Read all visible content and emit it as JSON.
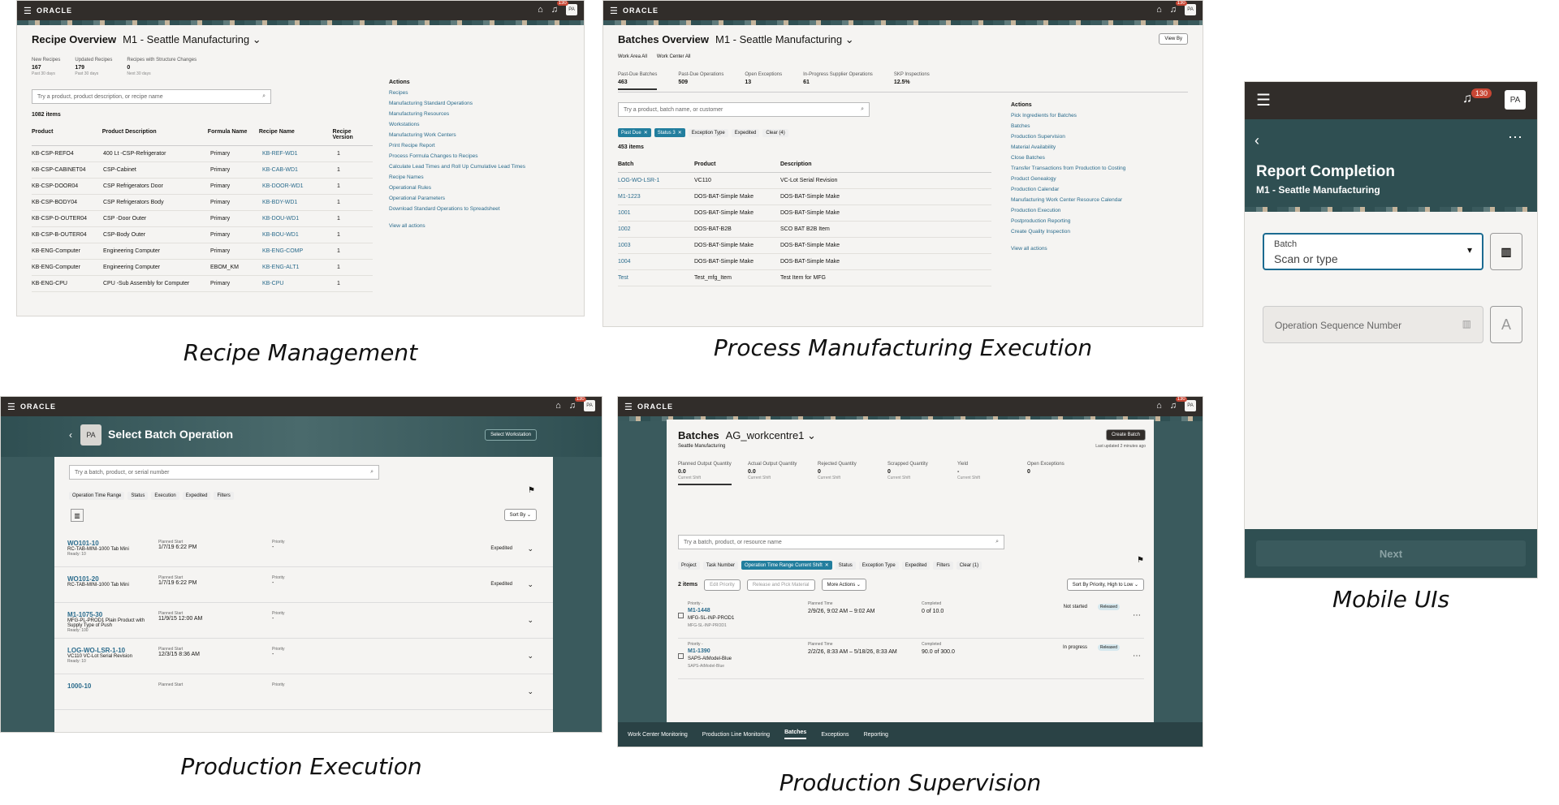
{
  "recipe": {
    "app_logo": "ORACLE",
    "title": "Recipe Overview",
    "context": "M1 - Seattle Manufacturing",
    "notif_count": "130",
    "avatar": "PA",
    "metrics": [
      {
        "label": "New Recipes",
        "value": "167",
        "sub": "Past 30 days"
      },
      {
        "label": "Updated Recipes",
        "value": "179",
        "sub": "Past 30 days"
      },
      {
        "label": "Recipes with Structure Changes",
        "value": "0",
        "sub": "Next 30 days"
      }
    ],
    "search_placeholder": "Try a product, product description, or recipe name",
    "count": "1082 items",
    "columns": [
      "Product",
      "Product Description",
      "Formula Name",
      "Recipe Name",
      "Recipe Version"
    ],
    "rows": [
      [
        "KB-CSP-REFO4",
        "400 Lt -CSP-Refrigerator",
        "Primary",
        "KB-REF-WD1",
        "1"
      ],
      [
        "KB-CSP-CABINET04",
        "CSP-Cabinet",
        "Primary",
        "KB-CAB-WD1",
        "1"
      ],
      [
        "KB-CSP-DOOR04",
        "CSP Refrigerators Door",
        "Primary",
        "KB-DOOR-WD1",
        "1"
      ],
      [
        "KB-CSP-BODY04",
        "CSP Refrigerators Body",
        "Primary",
        "KB-BDY-WD1",
        "1"
      ],
      [
        "KB-CSP-D-OUTER04",
        "CSP -Door Outer",
        "Primary",
        "KB-DOU-WD1",
        "1"
      ],
      [
        "KB-CSP-B-OUTER04",
        "CSP-Body Outer",
        "Primary",
        "KB-BOU-WD1",
        "1"
      ],
      [
        "KB-ENG-Computer",
        "Engineering Computer",
        "Primary",
        "KB-ENG-COMP",
        "1"
      ],
      [
        "KB-ENG-Computer",
        "Engineering Computer",
        "EBOM_KM",
        "KB-ENG-ALT1",
        "1"
      ],
      [
        "KB-ENG-CPU",
        "CPU -Sub Assembly for Computer",
        "Primary",
        "KB-CPU",
        "1"
      ]
    ],
    "actions_title": "Actions",
    "actions": [
      "Recipes",
      "Manufacturing Standard Operations",
      "Manufacturing Resources",
      "Workstations",
      "Manufacturing Work Centers",
      "Print Recipe Report",
      "Process Formula Changes to Recipes",
      "Calculate Lead Times and Roll Up Cumulative Lead Times",
      "Recipe Names",
      "Operational Rules",
      "Operational Parameters",
      "Download Standard Operations to Spreadsheet"
    ],
    "view_all": "View all actions",
    "caption": "Recipe Management"
  },
  "pme": {
    "app_logo": "ORACLE",
    "title": "Batches Overview",
    "context": "M1 - Seattle Manufacturing",
    "view_by": "View By",
    "notif_count": "130",
    "avatar": "PA",
    "filters": [
      {
        "label": "Work Area",
        "value": "All"
      },
      {
        "label": "Work Center",
        "value": "All"
      }
    ],
    "metrics": [
      {
        "label": "Past-Due Batches",
        "value": "463"
      },
      {
        "label": "Past-Due Operations",
        "value": "509"
      },
      {
        "label": "Open Exceptions",
        "value": "13"
      },
      {
        "label": "In-Progress Supplier Operations",
        "value": "61"
      },
      {
        "label": "SKP Inspections",
        "value": "12.5%"
      }
    ],
    "search_placeholder": "Try a product, batch name, or customer",
    "chips": [
      {
        "label": "Past Due",
        "sel": true
      },
      {
        "label": "Status 3",
        "sel": true
      },
      {
        "label": "Exception Type",
        "sel": false
      },
      {
        "label": "Expedited",
        "sel": false
      },
      {
        "label": "Clear (4)",
        "sel": false
      }
    ],
    "count": "453 items",
    "columns": [
      "Batch",
      "Product",
      "Description"
    ],
    "rows": [
      [
        "LOG-WO-LSR-1",
        "VC110",
        "VC-Lot Serial Revision"
      ],
      [
        "M1-1223",
        "DOS-BAT-Simple Make",
        "DOS-BAT-Simple Make"
      ],
      [
        "1001",
        "DOS-BAT-Simple Make",
        "DOS-BAT-Simple Make"
      ],
      [
        "1002",
        "DOS-BAT-B2B",
        "SCO BAT B2B Item"
      ],
      [
        "1003",
        "DOS-BAT-Simple Make",
        "DOS-BAT-Simple Make"
      ],
      [
        "1004",
        "DOS-BAT-Simple Make",
        "DOS-BAT-Simple Make"
      ],
      [
        "Test",
        "Test_mfg_Item",
        "Test Item for MFG"
      ]
    ],
    "actions_title": "Actions",
    "actions": [
      "Pick Ingredients for Batches",
      "Batches",
      "Production Supervision",
      "Material Availability",
      "Close Batches",
      "Transfer Transactions from Production to Costing",
      "Product Genealogy",
      "Production Calendar",
      "Manufacturing Work Center Resource Calendar",
      "Production Execution",
      "Postproduction Reporting",
      "Create Quality Inspection"
    ],
    "view_all": "View all actions",
    "caption": "Process Manufacturing Execution"
  },
  "mobile": {
    "notif_count": "130",
    "avatar": "PA",
    "title": "Report Completion",
    "subtitle": "M1 - Seattle Manufacturing",
    "batch_label": "Batch",
    "batch_placeholder": "Scan or type",
    "op_placeholder": "Operation Sequence Number",
    "next": "Next",
    "caption": "Mobile UIs"
  },
  "pe": {
    "app_logo": "ORACLE",
    "notif_count": "130",
    "avatar": "PA",
    "title": "Select Batch Operation",
    "badge": "PA",
    "select_ws": "Select Workstation",
    "search_placeholder": "Try a batch, product, or serial number",
    "chips": [
      "Operation Time Range",
      "Status",
      "Execution",
      "Expedited",
      "Filters"
    ],
    "sort": "Sort By",
    "rows": [
      {
        "id": "WO101-10",
        "desc": "RC-TAB-MINI-1000 Tab Mini",
        "ready": "Ready: 10",
        "start_label": "Planned Start",
        "start": "1/7/19 6:22 PM",
        "prio_label": "Priority",
        "prio": "-",
        "tag": "Expedited"
      },
      {
        "id": "WO101-20",
        "desc": "RC-TAB-MINI-1000 Tab Mini",
        "ready": "",
        "start_label": "Planned Start",
        "start": "1/7/19 6:22 PM",
        "prio_label": "Priority",
        "prio": "-",
        "tag": "Expedited"
      },
      {
        "id": "M1-1075-30",
        "desc": "MFG-PL-PROD1 Plain Product with Supply Type of Push",
        "ready": "Ready: 100",
        "start_label": "Planned Start",
        "start": "11/9/15 12:00 AM",
        "prio_label": "Priority",
        "prio": "-",
        "tag": ""
      },
      {
        "id": "LOG-WO-LSR-1-10",
        "desc": "VC110 VC-Lot Serial Revision",
        "ready": "Ready: 10",
        "start_label": "Planned Start",
        "start": "12/3/15 8:36 AM",
        "prio_label": "Priority",
        "prio": "-",
        "tag": ""
      },
      {
        "id": "1000-10",
        "desc": "",
        "ready": "",
        "start_label": "Planned Start",
        "start": "",
        "prio_label": "Priority",
        "prio": "",
        "tag": ""
      }
    ],
    "caption": "Production Execution"
  },
  "ps": {
    "app_logo": "ORACLE",
    "notif_count": "130",
    "avatar": "PA",
    "title": "Batches",
    "context": "AG_workcentre1",
    "org": "Seattle Manufacturing",
    "create": "Create Batch",
    "updated": "Last updated 2 minutes ago",
    "metrics": [
      {
        "label": "Planned Output Quantity",
        "value": "0.0",
        "sub": "Current Shift"
      },
      {
        "label": "Actual Output Quantity",
        "value": "0.0",
        "sub": "Current Shift"
      },
      {
        "label": "Rejected Quantity",
        "value": "0",
        "sub": "Current Shift"
      },
      {
        "label": "Scrapped Quantity",
        "value": "0",
        "sub": "Current Shift"
      },
      {
        "label": "Yield",
        "value": "-",
        "sub": "Current Shift"
      },
      {
        "label": "Open Exceptions",
        "value": "0",
        "sub": ""
      }
    ],
    "search_placeholder": "Try a batch, product, or resource name",
    "chips": [
      {
        "label": "Project",
        "sel": false
      },
      {
        "label": "Task Number",
        "sel": false
      },
      {
        "label": "Operation Time Range Current Shift",
        "sel": true
      },
      {
        "label": "Status",
        "sel": false
      },
      {
        "label": "Exception Type",
        "sel": false
      },
      {
        "label": "Expedited",
        "sel": false
      },
      {
        "label": "Filters",
        "sel": false
      },
      {
        "label": "Clear (1)",
        "sel": false
      }
    ],
    "count": "2 items",
    "edit_priority": "Edit Priority",
    "release": "Release and Pick Material",
    "more": "More Actions",
    "sort": "Sort By Priority, High to Low",
    "rows": [
      {
        "prio": "Priority -",
        "id": "M1-1448",
        "item": "MFG-SL-INP-PROD1",
        "item2": "MFG-SL-INP-PROD1",
        "time_label": "Planned Time",
        "time": "2/9/26, 9:02 AM – 9:02 AM",
        "comp_label": "Completed",
        "comp": "0 of 10.0",
        "status": "Not started",
        "badge": "Released"
      },
      {
        "prio": "Priority -",
        "id": "M1-1390",
        "item": "SAPS-AtModel-Blue",
        "item2": "SAPS-AtModel-Blue",
        "time_label": "Planned Time",
        "time": "2/2/26, 8:33 AM – 5/18/26, 8:33 AM",
        "comp_label": "Completed",
        "comp": "90.0 of 300.0",
        "status": "In progress",
        "badge": "Released"
      }
    ],
    "tabs": [
      "Work Center Monitoring",
      "Production Line Monitoring",
      "Batches",
      "Exceptions",
      "Reporting"
    ],
    "caption": "Production Supervision"
  }
}
